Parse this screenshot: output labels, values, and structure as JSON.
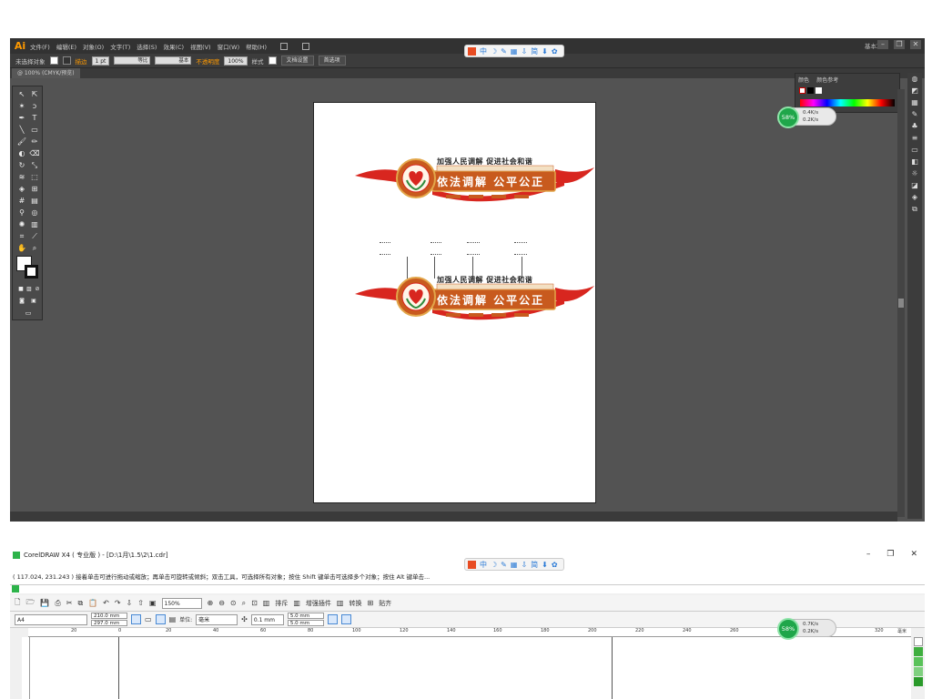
{
  "illustrator": {
    "logo": "Ai",
    "menus": [
      "文件(F)",
      "编辑(E)",
      "对象(O)",
      "文字(T)",
      "选择(S)",
      "效果(C)",
      "视图(V)",
      "窗口(W)",
      "帮助(H)"
    ],
    "workspace": "基本功能",
    "control": {
      "selection": "未选择对象",
      "stroke_label": "描边",
      "stroke_value": "1 pt",
      "profile": "等比",
      "brush": "基本",
      "opacity_label": "不透明度",
      "opacity_value": "100%",
      "style_label": "样式",
      "doc_setup": "文档设置",
      "prefs": "首选项"
    },
    "doc_tab": "@ 100% (CMYK/预览)",
    "panel_tabs": [
      "颜色",
      "颜色参考"
    ]
  },
  "artwork": {
    "title": "加强人民调解 促进社会和谐",
    "slogan": "依法调解 公平公正",
    "colors": {
      "red": "#d8261f",
      "orange": "#c85a1e",
      "gold": "#e2a64a",
      "green": "#2e8b3d"
    }
  },
  "overlay_toolbar": [
    "中",
    "☽",
    "✎",
    "▦",
    "⇩",
    "简",
    "⬇",
    "✿"
  ],
  "netspeed": {
    "percent": "58%",
    "up": "0.4K/s",
    "down": "0.2K/s"
  },
  "netspeed2": {
    "percent": "58%",
    "up": "0.7K/s",
    "down": "0.2K/s"
  },
  "coreldraw": {
    "title": "CorelDRAW X4 ( 专业版 ) - [D:\\1月\\1.5\\2\\1.cdr]",
    "status": "( 117.024, 231.243 )    接着单击可进行拖动或缩放；再单击可旋转或倾斜；双击工具，可选择所有对象；按住 Shift 键单击可选择多个对象；按住 Alt 键单击...",
    "zoom": "150%",
    "buttons": [
      "排斥",
      "增强插件",
      "转换",
      "贴齐"
    ],
    "page_size": "A4",
    "width": "210.0 mm",
    "height": "297.0 mm",
    "units_label": "单位:",
    "units": "毫米",
    "nudge": "0.1 mm",
    "dup_x": "5.0 mm",
    "dup_y": "5.0 mm",
    "ruler_unit": "毫米",
    "ruler_marks": [
      "20",
      "0",
      "20",
      "40",
      "60",
      "80",
      "100",
      "120",
      "140",
      "160",
      "180",
      "200",
      "220",
      "240",
      "260",
      "280",
      "300",
      "320"
    ]
  }
}
